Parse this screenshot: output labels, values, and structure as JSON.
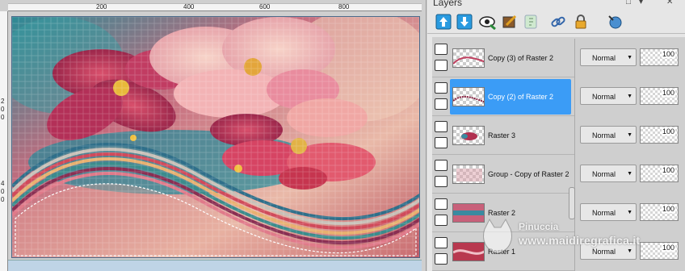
{
  "ruler": {
    "marks": [
      "200",
      "400",
      "600",
      "800"
    ],
    "v_digits": [
      "2",
      "0",
      "0",
      "4",
      "0",
      "0"
    ]
  },
  "panel": {
    "title": "Layers"
  },
  "toolbar": {
    "icons": [
      "new-raster-layer-icon",
      "new-vector-layer-icon",
      "view-all-layers-icon",
      "edit-selection-icon",
      "new-mask-icon",
      "link-layers-icon",
      "lock-transparency-icon",
      "palette-menu-icon"
    ]
  },
  "layers": [
    {
      "name": "Copy (3) of Raster 2",
      "blend": "Normal",
      "opacity": "100",
      "selected": false
    },
    {
      "name": "Copy (2) of Raster 2",
      "blend": "Normal",
      "opacity": "100",
      "selected": true
    },
    {
      "name": "Raster 3",
      "blend": "Normal",
      "opacity": "100",
      "selected": false
    },
    {
      "name": "Group - Copy of Raster 2",
      "blend": "Normal",
      "opacity": "100",
      "selected": false
    },
    {
      "name": "Raster 2",
      "blend": "Normal",
      "opacity": "100",
      "selected": false
    },
    {
      "name": "Raster 1",
      "blend": "Normal",
      "opacity": "100",
      "selected": false
    }
  ],
  "watermark": {
    "name": "Pinuccia",
    "site": "www.maidiregrafica.it"
  },
  "colors": {
    "selection": "#3b9cf6",
    "panel_bg": "#e6e6e6",
    "row_bg": "#d0d0d0"
  }
}
